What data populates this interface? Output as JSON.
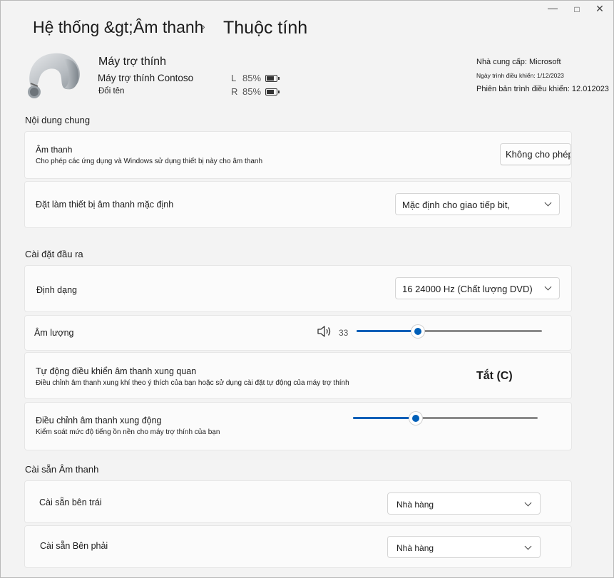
{
  "window": {
    "minimize": "—",
    "maximize": "□",
    "close": "✕"
  },
  "breadcrumb": {
    "level1": "Hệ thống &gt;",
    "level2": "Âm thanh",
    "separator": "›",
    "current": "Thuộc tính"
  },
  "device": {
    "name": "Máy trợ thính",
    "model": "Máy trợ thính Contoso",
    "rename_link": "Đổi tên",
    "battery_left": {
      "side": "L",
      "value": "85%"
    },
    "battery_right": {
      "side": "R",
      "value": "85%"
    }
  },
  "meta": {
    "vendor": "Nhà cung cấp: Microsoft",
    "driver_date": "Ngày trình điều khiển: 1/12/2023",
    "driver_version": "Phiên bản trình điều khiển: 12.012023"
  },
  "general": {
    "title": "Nội dung chung",
    "audio": {
      "title": "Âm thanh",
      "desc": "Cho phép các ứng dụng và Windows sử dụng thiết bị này cho âm thanh",
      "button": "Không cho phép"
    },
    "default_device": {
      "title": "Đặt làm thiết bị âm thanh mặc định",
      "selected": "Mặc định cho giao tiếp bit,"
    }
  },
  "output": {
    "title": "Cài đặt đầu ra",
    "format": {
      "title": "Định dạng",
      "selected": "16 24000 Hz (Chất lượng DVD)"
    },
    "volume": {
      "title": "Âm lượng",
      "icon": "speaker-icon",
      "value_label": "33",
      "level": 0.33
    },
    "auto_ambient": {
      "title": "Tự động điều khiển âm thanh xung quan",
      "desc": "Điều chỉnh âm thanh xung khí theo ý thích của bạn hoặc sử dụng cài đặt tự động của máy trợ thính",
      "state": "Tắt (C)"
    },
    "ambient": {
      "title": "Điều chỉnh âm thanh xung động",
      "desc": "Kiểm soát mức độ tiếng ồn nền cho máy trợ thính của bạn",
      "level": 0.34
    }
  },
  "presets": {
    "title": "Cài sẵn Âm thanh",
    "left": {
      "title": "Cài sẵn bên trái",
      "selected": "Nhà hàng"
    },
    "right": {
      "title": "Cài sẵn Bên phải",
      "selected": "Nhà hàng"
    }
  },
  "colors": {
    "accent": "#005fb8",
    "background": "#f3f3f3",
    "card": "#fbfbfb"
  }
}
